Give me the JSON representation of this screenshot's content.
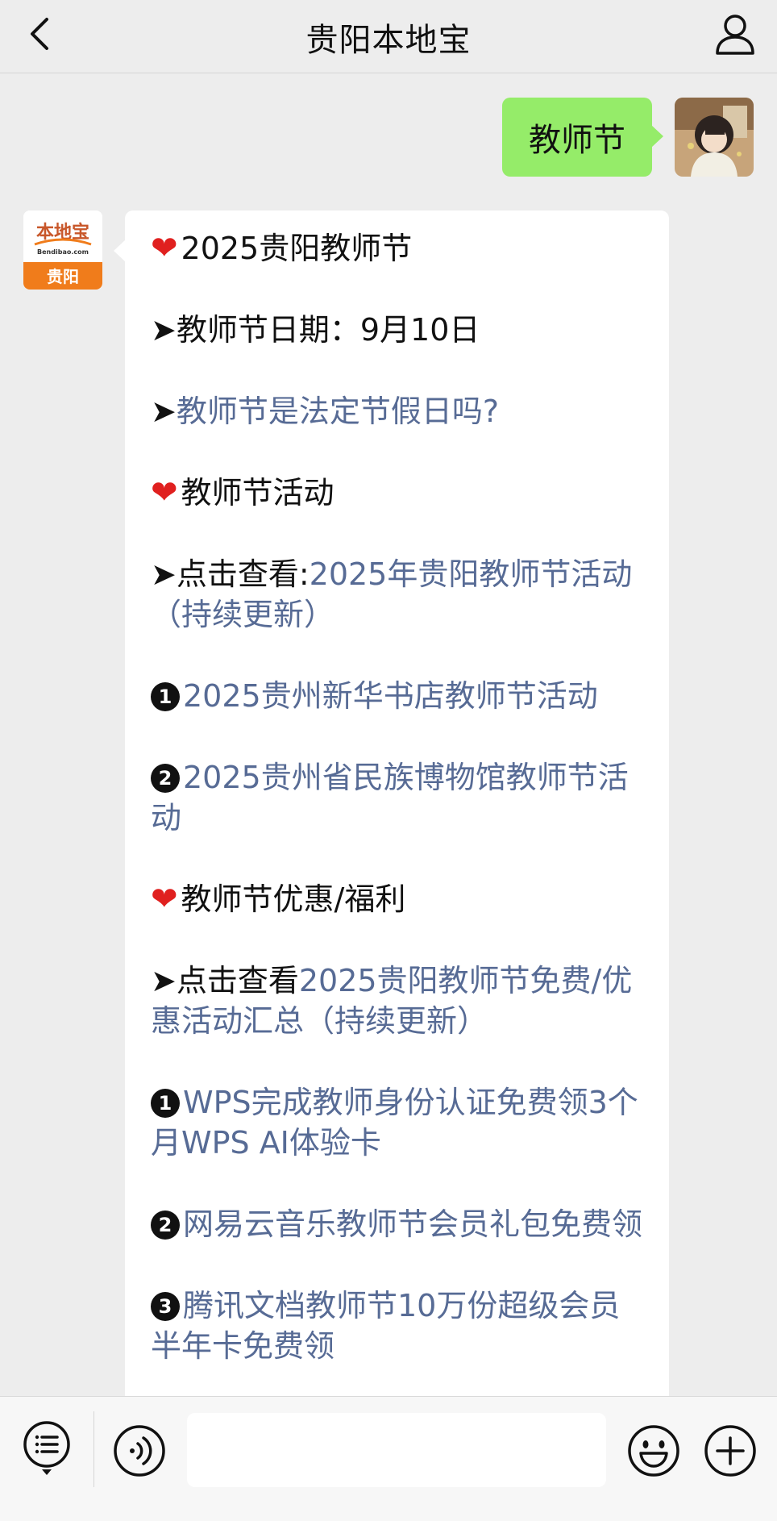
{
  "header": {
    "title": "贵阳本地宝"
  },
  "outgoing": {
    "text": "教师节"
  },
  "bot_avatar": {
    "logo_text": "本地宝",
    "logo_sub": "Bendibao.com",
    "city": "贵阳"
  },
  "message": {
    "title": "2025贵阳教师节",
    "date_line": "➤教师节日期：9月10日",
    "holiday_arrow": "➤",
    "holiday_link": "教师节是法定节假日吗?",
    "activities_heading": "教师节活动",
    "activities_prefix": "➤点击查看:",
    "activities_link": "2025年贵阳教师节活动（持续更新）",
    "activities": [
      {
        "num": "1",
        "text": "2025贵州新华书店教师节活动"
      },
      {
        "num": "2",
        "text": "2025贵州省民族博物馆教师节活动"
      }
    ],
    "benefits_heading": "教师节优惠/福利",
    "benefits_prefix": "➤点击查看",
    "benefits_link": "2025贵阳教师节免费/优惠活动汇总（持续更新）",
    "benefits": [
      {
        "num": "1",
        "text": "WPS完成教师身份认证免费领3个月WPS AI体验卡"
      },
      {
        "num": "2",
        "text": "网易云音乐教师节会员礼包免费领"
      },
      {
        "num": "3",
        "text": "腾讯文档教师节10万份超级会员半年卡免费领"
      }
    ]
  },
  "input": {
    "value": ""
  },
  "colors": {
    "bubble_out": "#95ec69",
    "link": "#576b95",
    "heart": "#e0201f",
    "logo_orange": "#f07c1b"
  }
}
